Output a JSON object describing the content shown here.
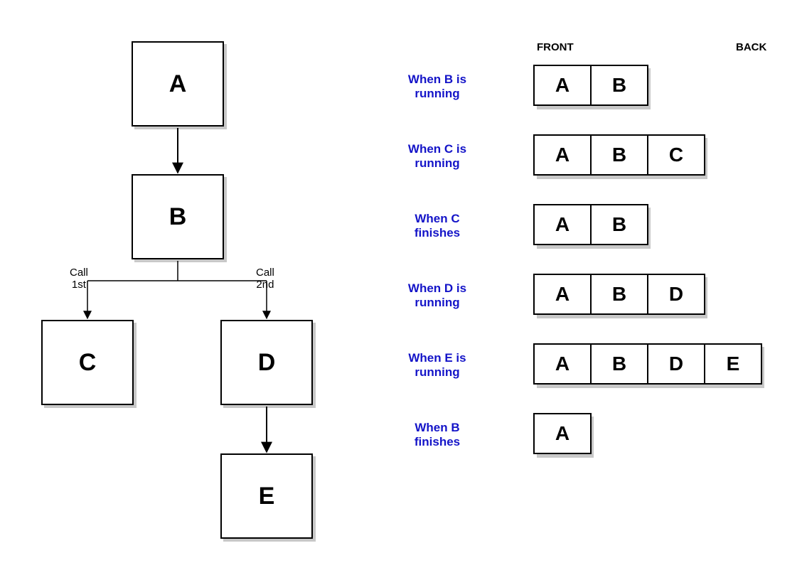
{
  "tree": {
    "nodes": {
      "A": "A",
      "B": "B",
      "C": "C",
      "D": "D",
      "E": "E"
    },
    "edge_labels": {
      "call_first": "Call\n1st",
      "call_second": "Call\n2nd"
    }
  },
  "headers": {
    "front": "FRONT",
    "back": "BACK"
  },
  "states": [
    {
      "label": "When B is\nrunning",
      "cells": [
        "A",
        "B"
      ]
    },
    {
      "label": "When C is\nrunning",
      "cells": [
        "A",
        "B",
        "C"
      ]
    },
    {
      "label": "When C\nfinishes",
      "cells": [
        "A",
        "B"
      ]
    },
    {
      "label": "When D is\nrunning",
      "cells": [
        "A",
        "B",
        "D"
      ]
    },
    {
      "label": "When E is\nrunning",
      "cells": [
        "A",
        "B",
        "D",
        "E"
      ]
    },
    {
      "label": "When B\nfinishes",
      "cells": [
        "A"
      ]
    }
  ]
}
